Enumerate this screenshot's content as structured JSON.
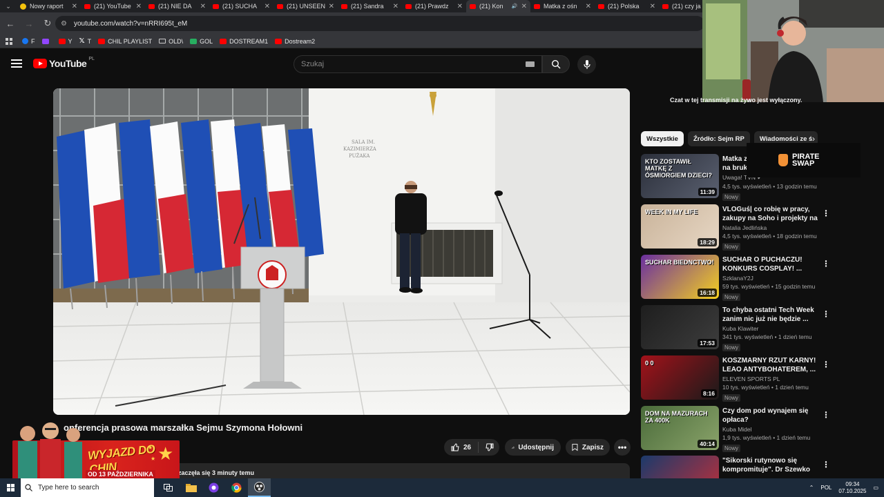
{
  "browser": {
    "tabs": [
      {
        "title": "Nowy raport",
        "favicon": "yellow"
      },
      {
        "title": "(21) YouTube",
        "favicon": "youtube"
      },
      {
        "title": "(21) NIE DA",
        "favicon": "youtube"
      },
      {
        "title": "(21) SUCHA",
        "favicon": "youtube"
      },
      {
        "title": "(21) UNSEEN",
        "favicon": "youtube"
      },
      {
        "title": "(21) Sandra",
        "favicon": "youtube"
      },
      {
        "title": "(21) Prawdz",
        "favicon": "youtube"
      },
      {
        "title": "(21) Kon",
        "favicon": "youtube",
        "active": true
      },
      {
        "title": "Matka z ośn",
        "favicon": "youtube"
      },
      {
        "title": "(21) Polska",
        "favicon": "youtube"
      },
      {
        "title": "(21) czy ja",
        "favicon": "youtube"
      }
    ],
    "url": "youtube.com/watch?v=nRRI695t_eM",
    "bookmarks": [
      {
        "label": "F",
        "icon": "fb"
      },
      {
        "label": "",
        "icon": "tw"
      },
      {
        "label": "Y",
        "icon": "yt"
      },
      {
        "label": "T",
        "icon": "x"
      },
      {
        "label": "CHIL PLAYLIST",
        "icon": "yt"
      },
      {
        "label": "OLD\\",
        "icon": "folder"
      },
      {
        "label": "GOL",
        "icon": "gol"
      },
      {
        "label": "DOSTREAM1",
        "icon": "yt"
      },
      {
        "label": "Dostream2",
        "icon": "yt"
      }
    ]
  },
  "youtube": {
    "logo_text": "YouTube",
    "country": "PL",
    "search_placeholder": "Szukaj"
  },
  "video": {
    "title": "Konferencja prasowa marszałka Sejmu Szymona Hołowni",
    "title_visible": "onferencja prasowa marszałka Sejmu Szymona Hołowni",
    "likes": "26",
    "share_label": "Udostępnij",
    "save_label": "Zapisz",
    "description": "zaczęła się 3 minuty temu",
    "scene_wall_sign": "SALA IM. KAZIMIERZA PUŻAKA"
  },
  "promo": {
    "title_line1": "WYJAZD",
    "title_line2": "DO CHIN",
    "date": "OD 13 PAŹDZIERNIKA"
  },
  "chat_note": "Czat w tej transmisji na żywo jest wyłączony.",
  "chips": [
    "Wszystkie",
    "Źródło: Sejm RP",
    "Wiadomości ze ś"
  ],
  "sponsor": {
    "line1": "PIRATE",
    "line2": "SWAP"
  },
  "recommendations": [
    {
      "title": "Matka z ośmiorgiem dzieci na bruk?",
      "title_visible": "Matka z\nna bruk?",
      "channel": "Uwaga! TVN",
      "verified": true,
      "meta": "4,5 tys. wyświetleń • 13 godzin temu",
      "badge": "Nowy",
      "duration": "11:39",
      "thumb_text": "KTO ZOSTAWIŁ MATKĘ Z ÓSMIORGIEM DZIECI?",
      "colors": [
        "#2b2f3a",
        "#5a6070"
      ]
    },
    {
      "title": "VLOGuś| co robię w pracy, zakupy na Soho i projekty na ...",
      "channel": "Natalia Jedlińska",
      "verified": false,
      "meta": "4,5 tys. wyświetleń • 18 godzin temu",
      "badge": "Nowy",
      "duration": "18:29",
      "thumb_text": "WEEK IN MY LIFE",
      "colors": [
        "#c9b39a",
        "#e7d7c4"
      ]
    },
    {
      "title": "SUCHAR O PUCHACZU! KONKURS COSPLAY! ...",
      "channel": "SzklanaY2J",
      "verified": false,
      "meta": "59 tys. wyświetleń • 15 godzin temu",
      "badge": "Nowy",
      "duration": "16:18",
      "thumb_text": "SUCHAR BIEDNCTWO!",
      "colors": [
        "#6a2fa0",
        "#f5d020"
      ]
    },
    {
      "title": "To chyba ostatni Tech Week zanim nic już nie będzie ...",
      "channel": "Kuba Klawiter",
      "verified": false,
      "meta": "341 tys. wyświetleń • 1 dzień temu",
      "badge": "Nowy",
      "duration": "17:53",
      "thumb_text": "",
      "colors": [
        "#1e1e1e",
        "#3d3d3d"
      ]
    },
    {
      "title": "KOSZMARNY RZUT KARNY! LEAO ANTYBOHATEREM, ...",
      "channel": "ELEVEN SPORTS PL",
      "verified": false,
      "meta": "10 tys. wyświetleń • 1 dzień temu",
      "badge": "Nowy",
      "duration": "8:16",
      "thumb_text": "0 0",
      "colors": [
        "#a3121a",
        "#1a1a1a"
      ]
    },
    {
      "title": "Czy dom pod wynajem się opłaca?",
      "channel": "Kuba Midel",
      "verified": false,
      "meta": "1,9 tys. wyświetleń • 1 dzień temu",
      "badge": "Nowy",
      "duration": "40:14",
      "thumb_text": "DOM NA MAZURACH ZA 400K",
      "colors": [
        "#4a6b3a",
        "#8aa36a"
      ]
    },
    {
      "title": "\"Sikorski rutynowo się kompromituje\". Dr Szewko ...",
      "channel": "",
      "verified": false,
      "meta": "",
      "badge": "",
      "duration": "",
      "thumb_text": "",
      "colors": [
        "#1b3a6b",
        "#c0303a"
      ]
    }
  ],
  "taskbar": {
    "search_placeholder": "Type here to search",
    "language": "POL",
    "time": "09:34",
    "date": "07.10.2025"
  },
  "icons": [
    "menu-icon",
    "search-icon",
    "mic-icon",
    "keyboard-icon",
    "like-icon",
    "dislike-icon",
    "share-icon",
    "save-icon",
    "more-icon",
    "back-icon",
    "forward-icon",
    "reload-icon",
    "apps-icon",
    "windows-icon",
    "chevron-right-icon"
  ]
}
